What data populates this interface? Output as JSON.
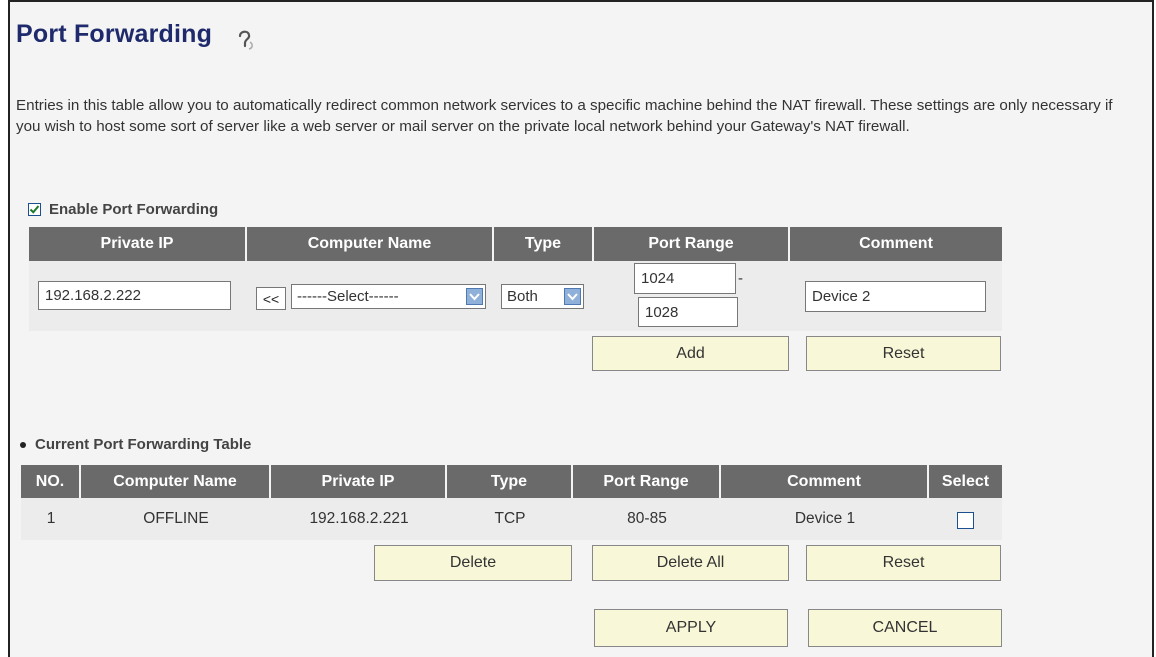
{
  "page": {
    "title": "Port Forwarding",
    "description": "Entries in this table allow you to automatically redirect common network services to a specific machine behind the NAT firewall. These settings are only necessary if you wish to host some sort of server like a web server or mail server on the private local network behind your Gateway's NAT firewall.",
    "help_icon": "help-question-icon"
  },
  "enable": {
    "label": "Enable Port Forwarding",
    "checked": true
  },
  "entry_table": {
    "headers": [
      "Private IP",
      "Computer Name",
      "Type",
      "Port Range",
      "Comment"
    ],
    "private_ip": "192.168.2.222",
    "copy_button": "<<",
    "computer_select": "------Select------",
    "type_select": "Both",
    "port_start": "1024",
    "port_separator": "-",
    "port_end": "1028",
    "comment": "Device 2",
    "add_label": "Add",
    "reset_label": "Reset"
  },
  "current_table": {
    "section_label": "Current Port Forwarding Table",
    "headers": [
      "NO.",
      "Computer Name",
      "Private IP",
      "Type",
      "Port Range",
      "Comment",
      "Select"
    ],
    "rows": [
      {
        "no": "1",
        "computer_name": "OFFLINE",
        "private_ip": "192.168.2.221",
        "type": "TCP",
        "port_range": "80-85",
        "comment": "Device 1",
        "selected": false
      }
    ],
    "delete_label": "Delete",
    "delete_all_label": "Delete All",
    "reset_label": "Reset"
  },
  "footer": {
    "apply_label": "APPLY",
    "cancel_label": "CANCEL"
  },
  "colors": {
    "title": "#1e2a6b",
    "header_bg": "#6a6a6a",
    "button_bg": "#f8f7d8",
    "checkbox_border": "#1c4f8f"
  }
}
